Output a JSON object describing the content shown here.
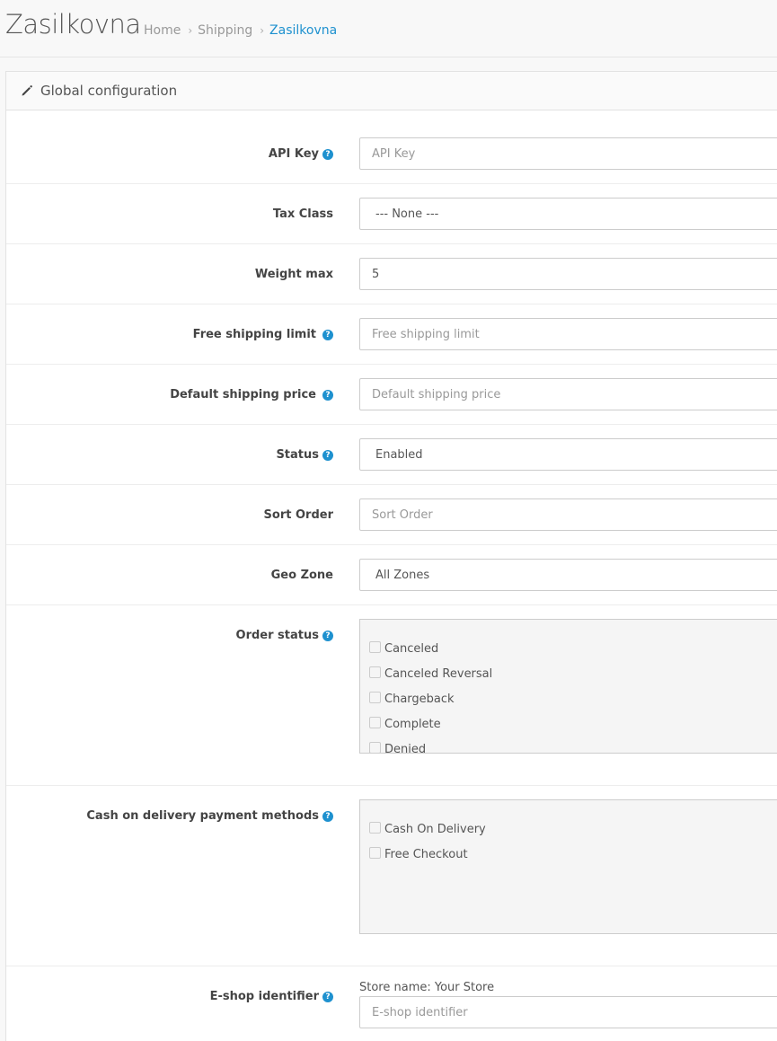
{
  "header": {
    "title": "Zasilkovna",
    "breadcrumb": [
      {
        "label": "Home"
      },
      {
        "label": "Shipping"
      },
      {
        "label": "Zasilkovna"
      }
    ]
  },
  "panel": {
    "title": "Global configuration",
    "icon": "pencil-icon"
  },
  "fields": {
    "api_key": {
      "label": "API Key",
      "value": "",
      "placeholder": "API Key"
    },
    "tax_class": {
      "label": "Tax Class",
      "selected": "--- None ---"
    },
    "weight_max": {
      "label": "Weight max",
      "value": "5"
    },
    "free_shipping_limit": {
      "label": "Free shipping limit",
      "value": "",
      "placeholder": "Free shipping limit"
    },
    "default_shipping_price": {
      "label": "Default shipping price",
      "value": "",
      "placeholder": "Default shipping price"
    },
    "status": {
      "label": "Status",
      "selected": "Enabled"
    },
    "sort_order": {
      "label": "Sort Order",
      "value": "",
      "placeholder": "Sort Order"
    },
    "geo_zone": {
      "label": "Geo Zone",
      "selected": "All Zones"
    },
    "order_status": {
      "label": "Order status",
      "options": [
        "Canceled",
        "Canceled Reversal",
        "Chargeback",
        "Complete",
        "Denied"
      ]
    },
    "cod_methods": {
      "label": "Cash on delivery payment methods",
      "options": [
        "Cash On Delivery",
        "Free Checkout"
      ]
    },
    "eshop_identifier": {
      "label": "E-shop identifier",
      "store_name": "Store name: Your Store",
      "value": "",
      "placeholder": "E-shop identifier"
    }
  },
  "help_glyph": "?",
  "colors": {
    "accent": "#1e91cf",
    "help": "#1e91cf"
  }
}
